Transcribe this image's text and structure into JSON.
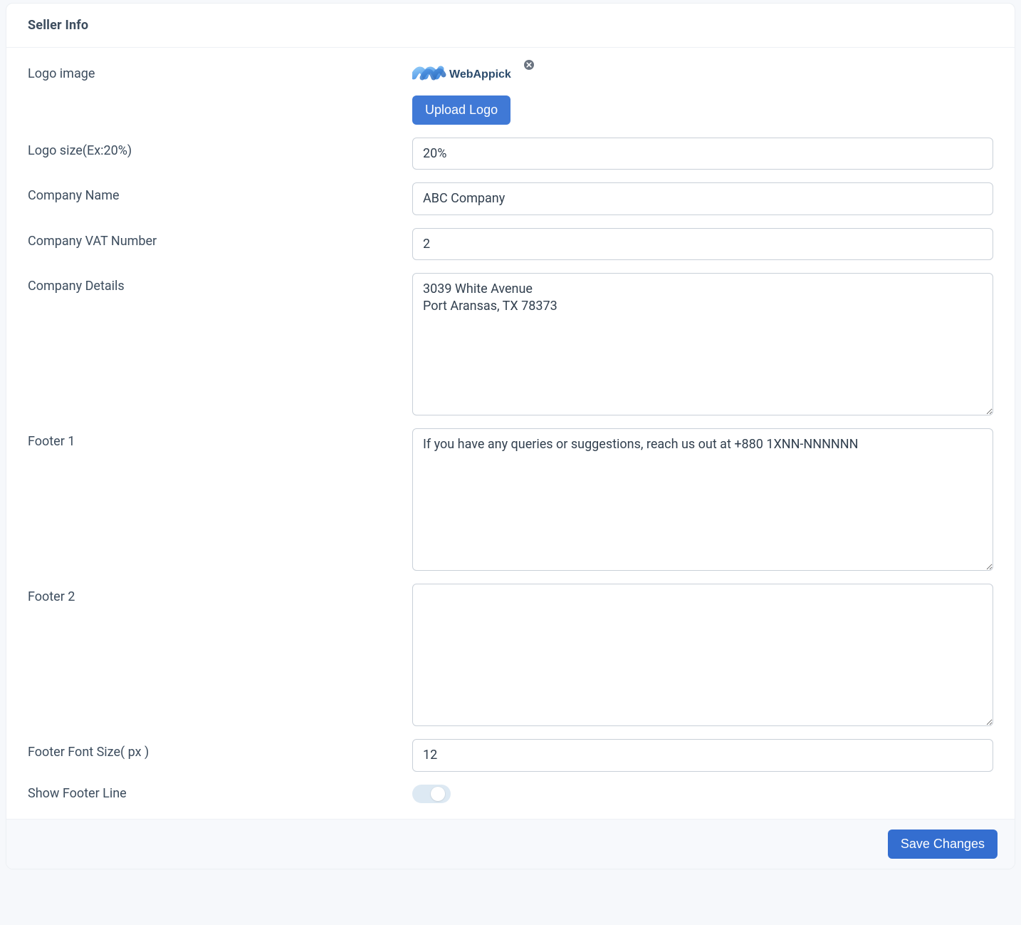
{
  "section_title": "Seller Info",
  "labels": {
    "logo_image": "Logo image",
    "logo_size": "Logo size(Ex:20%)",
    "company_name": "Company Name",
    "company_vat": "Company VAT Number",
    "company_details": "Company Details",
    "footer1": "Footer 1",
    "footer2": "Footer 2",
    "footer_font_size": "Footer Font Size( px )",
    "show_footer_line": "Show Footer Line"
  },
  "buttons": {
    "upload_logo": "Upload Logo",
    "save_changes": "Save Changes"
  },
  "values": {
    "logo_text": "WebAppick",
    "logo_size": "20%",
    "company_name": "ABC Company",
    "company_vat": "2",
    "company_details": "3039 White Avenue\nPort Aransas, TX 78373",
    "footer1": "If you have any queries or suggestions, reach us out at +880 1XNN-NNNNNN",
    "footer2": "",
    "footer_font_size": "12",
    "show_footer_line": false
  },
  "colors": {
    "primary": "#4079d6",
    "logo_light": "#71b4f4",
    "logo_dark": "#2f72c8"
  }
}
